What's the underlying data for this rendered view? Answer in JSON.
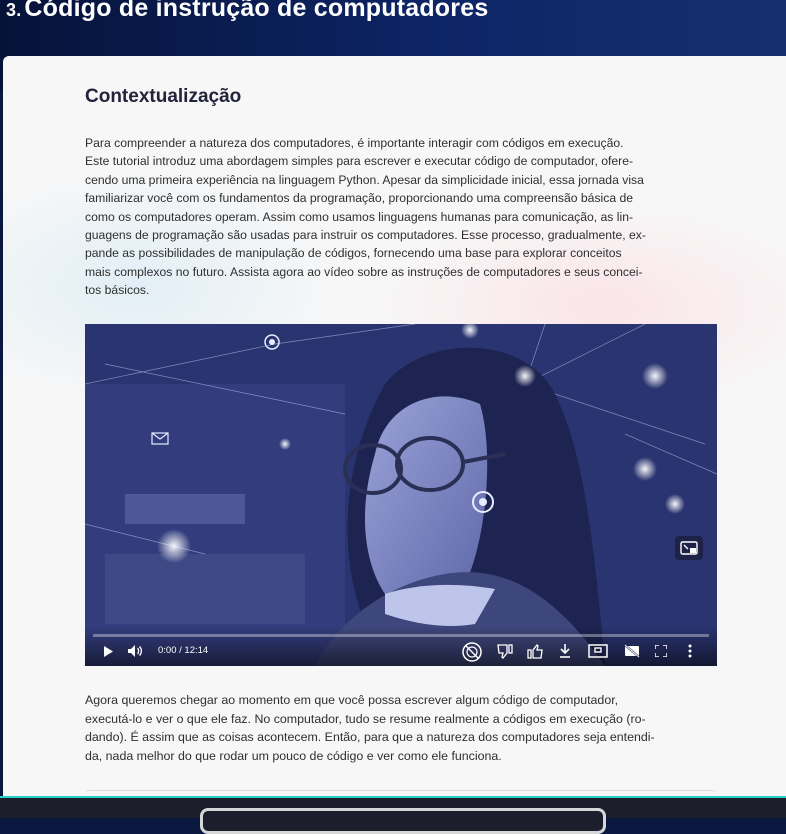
{
  "header": {
    "number": "3.",
    "title": "Código de instrução de computadores"
  },
  "section": {
    "title": "Contextualização"
  },
  "intro_lines": [
    "Para compreender a natureza dos computadores, é importante interagir com códigos em execução.",
    "Este tutorial introduz uma abordagem simples para escrever e executar código de computador, ofere-",
    "cendo uma primeira experiência na linguagem Python. Apesar da simplicidade inicial, essa jornada visa",
    "familiarizar você com os fundamentos da programação, proporcionando uma compreensão básica de",
    "como os computadores operam. Assim como usamos linguagens humanas para comunicação, as lin-",
    "guagens de programação são usadas para instruir os computadores. Esse processo, gradualmente, ex-",
    "pande as possibilidades de manipulação de códigos, fornecendo uma base para explorar conceitos",
    "mais complexos no futuro. Assista agora ao vídeo sobre as instruções de computadores e seus concei-",
    "tos básicos."
  ],
  "video": {
    "time": "0:00 / 12:14",
    "progress": 0,
    "controls": [
      "play-icon",
      "volume-icon",
      "ai-summary-icon",
      "dislike-icon",
      "like-icon",
      "download-icon",
      "miniplayer-icon",
      "captions-off-icon",
      "fullscreen-icon",
      "more-icon"
    ],
    "overlay_icon": "picture-in-picture-icon"
  },
  "outro_lines": [
    "Agora queremos chegar ao momento em que você possa escrever algum código de computador,",
    "executá-lo e ver o que ele faz. No computador, tudo se resume realmente a códigos em execução (ro-",
    "dando). É assim que as coisas acontecem. Então, para que a natureza dos computadores seja entendi-",
    "da, nada melhor do que rodar um pouco de código e ver como ele funciona."
  ],
  "colors": {
    "header_bg": "#0d2566",
    "accent": "#2bd1c7",
    "text": "#2f2f2f"
  }
}
